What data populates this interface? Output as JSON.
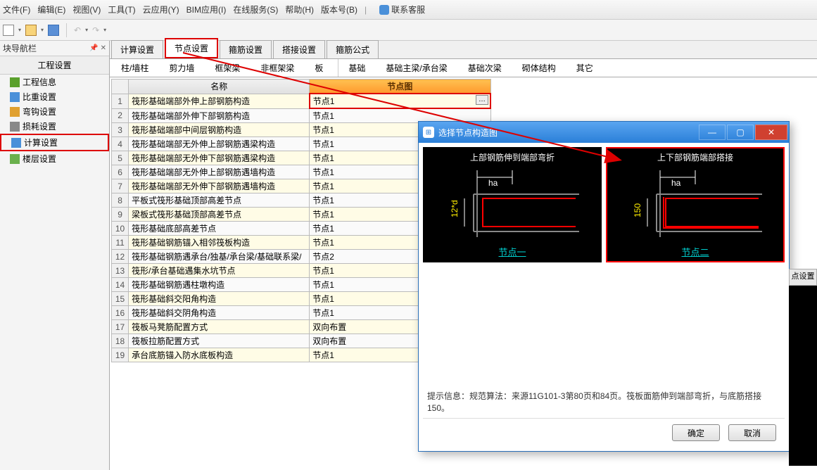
{
  "menu": {
    "items": [
      "文件(F)",
      "编辑(E)",
      "视图(V)",
      "工具(T)",
      "云应用(Y)",
      "BIM应用(I)",
      "在线服务(S)",
      "帮助(H)",
      "版本号(B)"
    ],
    "contact": "联系客服"
  },
  "nav": {
    "header": "块导航栏",
    "section": "工程设置",
    "items": [
      {
        "label": "工程信息"
      },
      {
        "label": "比重设置"
      },
      {
        "label": "弯钩设置"
      },
      {
        "label": "损耗设置"
      },
      {
        "label": "计算设置",
        "selected": true
      },
      {
        "label": "楼层设置"
      }
    ]
  },
  "tabs1": [
    {
      "label": "计算设置"
    },
    {
      "label": "节点设置",
      "active": true,
      "highlighted": true
    },
    {
      "label": "箍筋设置"
    },
    {
      "label": "搭接设置"
    },
    {
      "label": "箍筋公式"
    }
  ],
  "tabs2": [
    {
      "label": "柱/墙柱"
    },
    {
      "label": "剪力墙"
    },
    {
      "label": "框架梁"
    },
    {
      "label": "非框架梁"
    },
    {
      "label": "板"
    },
    {
      "label": "基础",
      "sepBefore": true,
      "active": true
    },
    {
      "label": "基础主梁/承台梁"
    },
    {
      "label": "基础次梁"
    },
    {
      "label": "砌体结构"
    },
    {
      "label": "其它"
    }
  ],
  "table": {
    "headers": {
      "name": "名称",
      "diagram": "节点图"
    },
    "rows": [
      {
        "n": 1,
        "name": "筏形基础端部外伸上部钢筋构造",
        "val": "节点1",
        "hl": true
      },
      {
        "n": 2,
        "name": "筏形基础端部外伸下部钢筋构造",
        "val": "节点1"
      },
      {
        "n": 3,
        "name": "筏形基础端部中间层钢筋构造",
        "val": "节点1"
      },
      {
        "n": 4,
        "name": "筏形基础端部无外伸上部钢筋遇梁构造",
        "val": "节点1"
      },
      {
        "n": 5,
        "name": "筏形基础端部无外伸下部钢筋遇梁构造",
        "val": "节点1"
      },
      {
        "n": 6,
        "name": "筏形基础端部无外伸上部钢筋遇墙构造",
        "val": "节点1"
      },
      {
        "n": 7,
        "name": "筏形基础端部无外伸下部钢筋遇墙构造",
        "val": "节点1"
      },
      {
        "n": 8,
        "name": "平板式筏形基础顶部高差节点",
        "val": "节点1"
      },
      {
        "n": 9,
        "name": "梁板式筏形基础顶部高差节点",
        "val": "节点1"
      },
      {
        "n": 10,
        "name": "筏形基础底部高差节点",
        "val": "节点1"
      },
      {
        "n": 11,
        "name": "筏形基础钢筋锚入相邻筏板构造",
        "val": "节点1"
      },
      {
        "n": 12,
        "name": "筏形基础钢筋遇承台/独基/承台梁/基础联系梁/",
        "val": "节点2"
      },
      {
        "n": 13,
        "name": "筏形/承台基础遇集水坑节点",
        "val": "节点1"
      },
      {
        "n": 14,
        "name": "筏形基础钢筋遇柱墩构造",
        "val": "节点1"
      },
      {
        "n": 15,
        "name": "筏形基础斜交阳角构造",
        "val": "节点1"
      },
      {
        "n": 16,
        "name": "筏形基础斜交阴角构造",
        "val": "节点1"
      },
      {
        "n": 17,
        "name": "筏板马凳筋配置方式",
        "val": "双向布置"
      },
      {
        "n": 18,
        "name": "筏板拉筋配置方式",
        "val": "双向布置"
      },
      {
        "n": 19,
        "name": "承台底筋锚入防水底板构造",
        "val": "节点1"
      }
    ]
  },
  "dialog": {
    "title": "选择节点构造图",
    "diagrams": [
      {
        "title": "上部钢筋伸到端部弯折",
        "ha": "ha",
        "side": "12*d",
        "label": "节点一"
      },
      {
        "title": "上下部钢筋端部搭接",
        "ha": "ha",
        "side": "150",
        "label": "节点二",
        "selected": true
      }
    ],
    "hint": "提示信息：规范算法：来源11G101-3第80页和84页。筏板面筋伸到端部弯折，与底筋搭接150。",
    "ok": "确定",
    "cancel": "取消"
  },
  "rightStrip": {
    "tab": "点设置"
  }
}
